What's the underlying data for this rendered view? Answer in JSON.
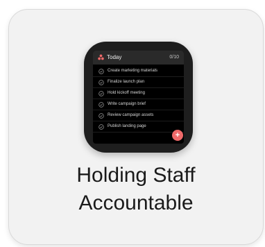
{
  "widget": {
    "title": "Today",
    "count": "0/10",
    "tasks": [
      {
        "label": "Create marketing materials"
      },
      {
        "label": "Finalize launch plan"
      },
      {
        "label": "Hold kickoff meeting"
      },
      {
        "label": "Write campaign brief"
      },
      {
        "label": "Review campaign assets"
      },
      {
        "label": "Publish landing page"
      }
    ],
    "add_label": "+",
    "accent_color": "#f06a6a"
  },
  "caption": {
    "line1": "Holding Staff",
    "line2": "Accountable"
  }
}
